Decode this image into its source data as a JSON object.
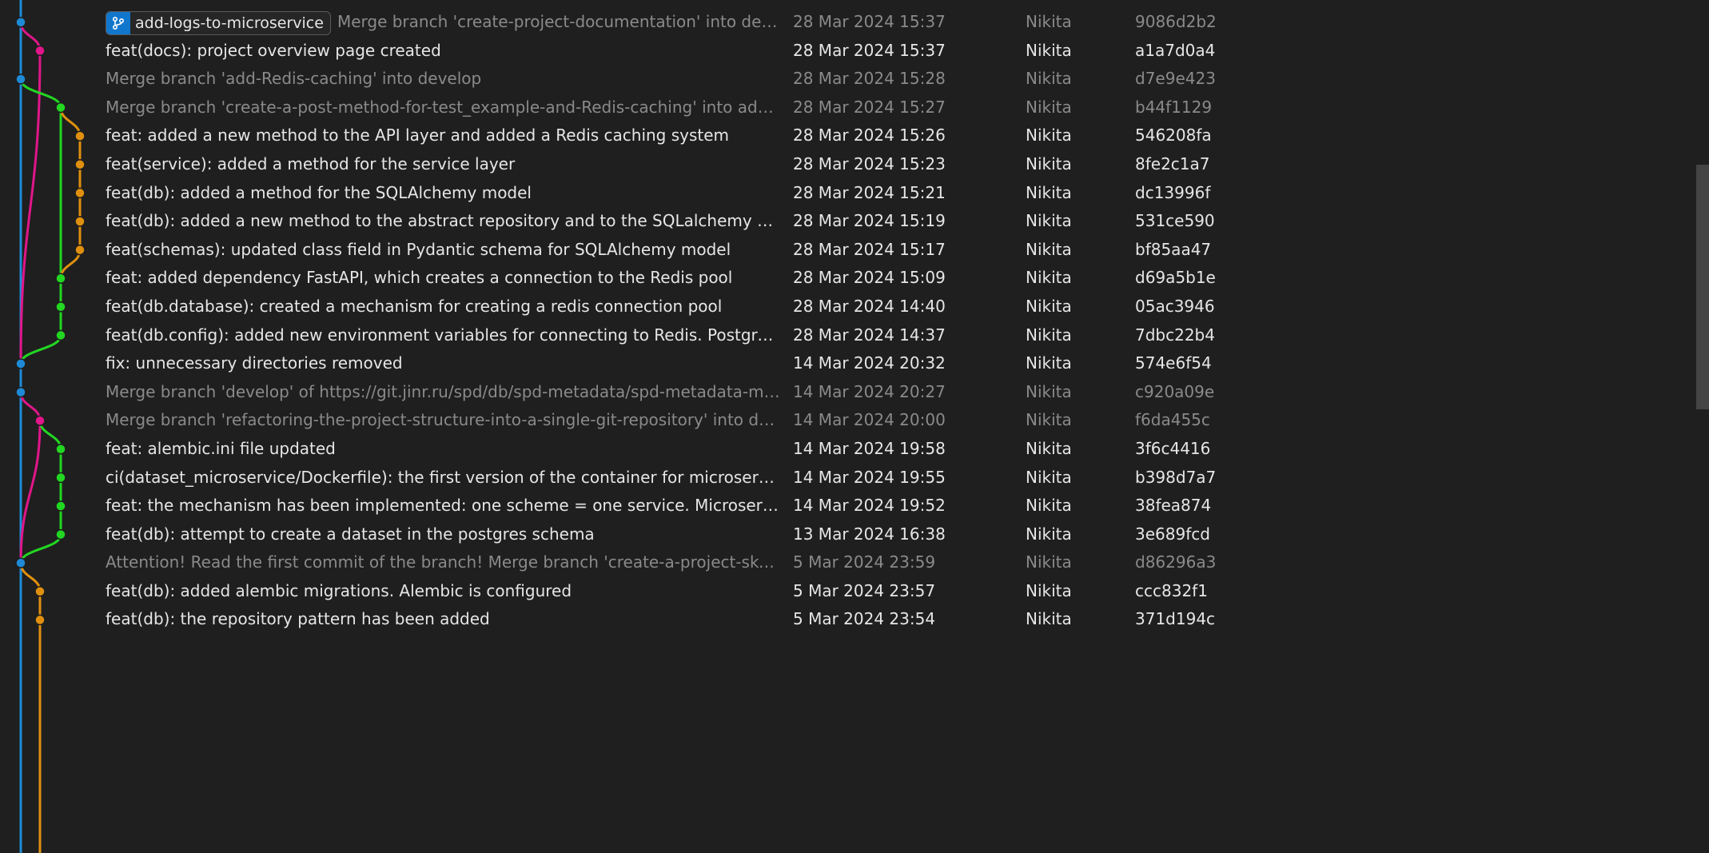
{
  "branch_badge": {
    "label": "add-logs-to-microservice",
    "icon": "git-branch-icon"
  },
  "colors": {
    "blue": "#1e8ad6",
    "magenta": "#e0168a",
    "green": "#22d622",
    "orange": "#e0900e"
  },
  "commits": [
    {
      "message": "Merge branch 'create-project-documentation' into develop",
      "date": "28 Mar 2024 15:37",
      "author": "Nikita",
      "hash": "9086d2b2",
      "merge": true
    },
    {
      "message": "feat(docs): project overview page created",
      "date": "28 Mar 2024 15:37",
      "author": "Nikita",
      "hash": "a1a7d0a4",
      "merge": false
    },
    {
      "message": "Merge branch 'add-Redis-caching' into develop",
      "date": "28 Mar 2024 15:28",
      "author": "Nikita",
      "hash": "d7e9e423",
      "merge": true
    },
    {
      "message": "Merge branch 'create-a-post-method-for-test_example-and-Redis-caching' into add-Redi…",
      "date": "28 Mar 2024 15:27",
      "author": "Nikita",
      "hash": "b44f1129",
      "merge": true
    },
    {
      "message": "feat: added a new method to the API layer and added a Redis caching system",
      "date": "28 Mar 2024 15:26",
      "author": "Nikita",
      "hash": "546208fa",
      "merge": false
    },
    {
      "message": "feat(service): added a method for the service layer",
      "date": "28 Mar 2024 15:23",
      "author": "Nikita",
      "hash": "8fe2c1a7",
      "merge": false
    },
    {
      "message": "feat(db): added a method for the SQLAlchemy model",
      "date": "28 Mar 2024 15:21",
      "author": "Nikita",
      "hash": "dc13996f",
      "merge": false
    },
    {
      "message": "feat(db): added a new method to the abstract repository and to the SQLalchemy Reposit…",
      "date": "28 Mar 2024 15:19",
      "author": "Nikita",
      "hash": "531ce590",
      "merge": false
    },
    {
      "message": "feat(schemas): updated class field in Pydantic schema for SQLAlchemy model",
      "date": "28 Mar 2024 15:17",
      "author": "Nikita",
      "hash": "bf85aa47",
      "merge": false
    },
    {
      "message": "feat: added dependency FastAPI, which creates a connection to the Redis pool",
      "date": "28 Mar 2024 15:09",
      "author": "Nikita",
      "hash": "d69a5b1e",
      "merge": false
    },
    {
      "message": "feat(db.database): created a mechanism for creating a redis connection pool",
      "date": "28 Mar 2024 14:40",
      "author": "Nikita",
      "hash": "05ac3946",
      "merge": false
    },
    {
      "message": "feat(db.config): added new environment variables for connecting to Redis. Postgres vari…",
      "date": "28 Mar 2024 14:37",
      "author": "Nikita",
      "hash": "7dbc22b4",
      "merge": false
    },
    {
      "message": "fix: unnecessary directories removed",
      "date": "14 Mar 2024 20:32",
      "author": "Nikita",
      "hash": "574e6f54",
      "merge": false
    },
    {
      "message": "Merge branch 'develop' of https://git.jinr.ru/spd/db/spd-metadata/spd-metadata-micros…",
      "date": "14 Mar 2024 20:27",
      "author": "Nikita",
      "hash": "c920a09e",
      "merge": true
    },
    {
      "message": "Merge branch 'refactoring-the-project-structure-into-a-single-git-repository' into develop",
      "date": "14 Mar 2024 20:00",
      "author": "Nikita",
      "hash": "f6da455c",
      "merge": true
    },
    {
      "message": "feat: alembic.ini file updated",
      "date": "14 Mar 2024 19:58",
      "author": "Nikita",
      "hash": "3f6c4416",
      "merge": false
    },
    {
      "message": "ci(dataset_microservice/Dockerfile): the first version of the container for microservice",
      "date": "14 Mar 2024 19:55",
      "author": "Nikita",
      "hash": "b398d7a7",
      "merge": false
    },
    {
      "message": "feat: the mechanism has been implemented: one scheme = one service. Microservices ar…",
      "date": "14 Mar 2024 19:52",
      "author": "Nikita",
      "hash": "38fea874",
      "merge": false
    },
    {
      "message": "feat(db): attempt to create a dataset in the postgres schema",
      "date": "13 Mar 2024 16:38",
      "author": "Nikita",
      "hash": "3e689fcd",
      "merge": false
    },
    {
      "message": "Attention! Read the first commit of the branch! Merge branch 'create-a-project-skeleton-…",
      "date": "5 Mar 2024 23:59",
      "author": "Nikita",
      "hash": "d86296a3",
      "merge": true
    },
    {
      "message": "feat(db): added alembic migrations. Alembic is configured",
      "date": "5 Mar 2024 23:57",
      "author": "Nikita",
      "hash": "ccc832f1",
      "merge": false
    },
    {
      "message": "feat(db): the repository pattern has been added",
      "date": "5 Mar 2024 23:54",
      "author": "Nikita",
      "hash": "371d194c",
      "merge": false
    }
  ]
}
